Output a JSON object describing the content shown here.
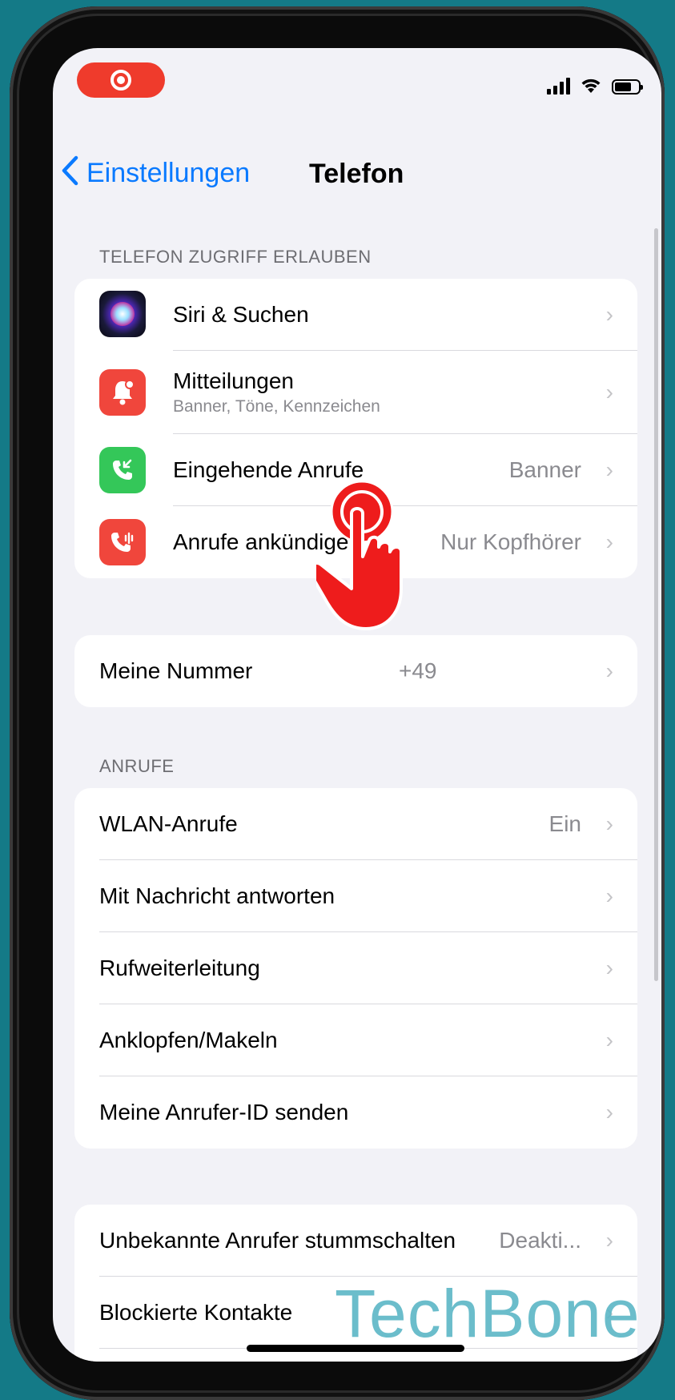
{
  "status": {
    "recording_icon": "screen-recording-icon",
    "icons": [
      "cellular-signal-icon",
      "wifi-icon",
      "battery-icon"
    ]
  },
  "nav": {
    "back_label": "Einstellungen",
    "title": "Telefon"
  },
  "section_access": {
    "header": "TELEFON ZUGRIFF ERLAUBEN",
    "rows": [
      {
        "label": "Siri & Suchen",
        "sublabel": "",
        "value": "",
        "icon": "siri-icon"
      },
      {
        "label": "Mitteilungen",
        "sublabel": "Banner, Töne, Kennzeichen",
        "value": "",
        "icon": "notifications-icon"
      },
      {
        "label": "Eingehende Anrufe",
        "sublabel": "",
        "value": "Banner",
        "icon": "incoming-call-icon"
      },
      {
        "label": "Anrufe ankündigen",
        "sublabel": "",
        "value": "Nur Kopfhörer",
        "icon": "announce-calls-icon"
      }
    ]
  },
  "my_number": {
    "label": "Meine Nummer",
    "value": "+49"
  },
  "section_calls": {
    "header": "ANRUFE",
    "rows": [
      {
        "label": "WLAN-Anrufe",
        "value": "Ein"
      },
      {
        "label": "Mit Nachricht antworten",
        "value": ""
      },
      {
        "label": "Rufweiterleitung",
        "value": ""
      },
      {
        "label": "Anklopfen/Makeln",
        "value": ""
      },
      {
        "label": "Meine Anrufer-ID senden",
        "value": ""
      }
    ]
  },
  "section_block": {
    "rows": [
      {
        "label": "Unbekannte Anrufer stummschalten",
        "value": "Deakti..."
      },
      {
        "label": "Blockierte Kontakte",
        "value": ""
      }
    ]
  },
  "watermark": "TechBone",
  "colors": {
    "accent": "#0a7aff",
    "background": "#f2f2f7",
    "notifications_icon": "#f0463c",
    "incoming_call_icon": "#34c759",
    "announce_calls_icon": "#f0463c",
    "tap_indicator": "#ee1c1c",
    "frame_background": "#147a87"
  }
}
